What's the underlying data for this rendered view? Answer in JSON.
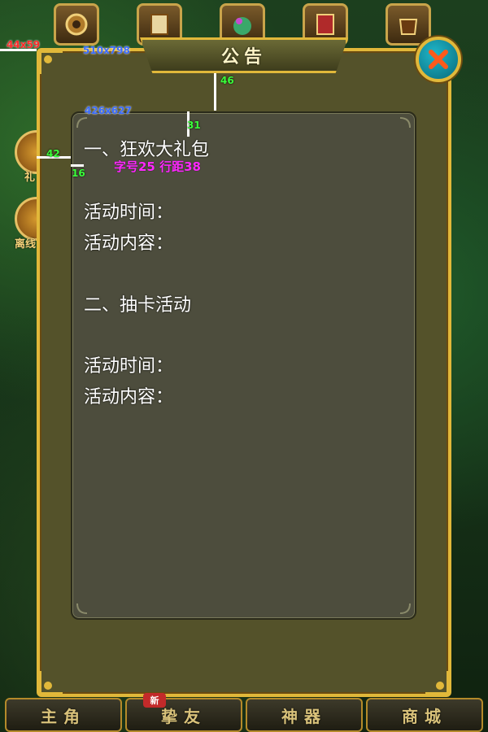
{
  "panel": {
    "title": "公告",
    "close_icon": "close-icon"
  },
  "content": {
    "lines": [
      "一、狂欢大礼包",
      "活动时间：",
      "活动内容：",
      "二、抽卡活动",
      "活动时间：",
      "活动内容："
    ]
  },
  "annotations": {
    "corner_size": "44x59",
    "panel_size": "510x798",
    "content_size": "426x627",
    "gap_top": "46",
    "gap_inner_top": "31",
    "gap_left": "42",
    "gap_inner_left": "16",
    "font_note": "字号25  行距38"
  },
  "side": {
    "labels": [
      "礼",
      "离线"
    ]
  },
  "nav": {
    "items": [
      "主角",
      "挚友",
      "神器",
      "商城"
    ],
    "new_badge": "新"
  },
  "colors": {
    "accent_gold": "#e1b83a",
    "panel_bg": "#54522a",
    "content_bg": "#4d4d3d",
    "close_teal": "#1fb6c9",
    "annotation_magenta": "#ff2aff"
  }
}
